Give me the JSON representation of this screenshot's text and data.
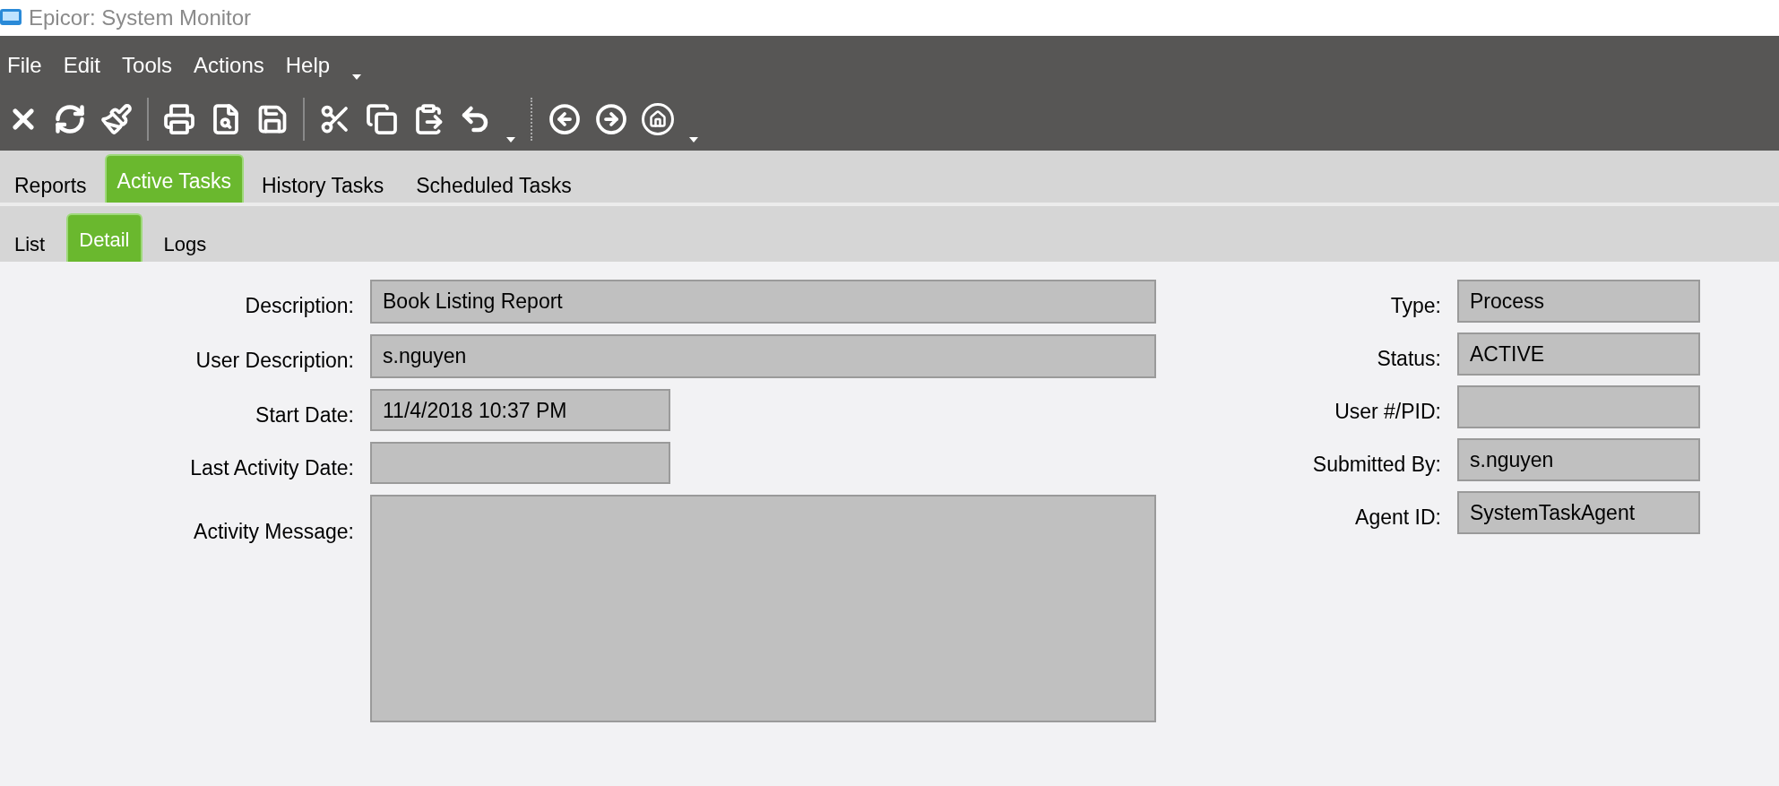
{
  "window": {
    "title": "Epicor: System Monitor"
  },
  "menu": [
    {
      "label": "File"
    },
    {
      "label": "Edit"
    },
    {
      "label": "Tools"
    },
    {
      "label": "Actions"
    },
    {
      "label": "Help"
    }
  ],
  "tabs": [
    {
      "label": "Reports",
      "selected": false
    },
    {
      "label": "Active Tasks",
      "selected": true
    },
    {
      "label": "History Tasks",
      "selected": false
    },
    {
      "label": "Scheduled Tasks",
      "selected": false
    }
  ],
  "subtabs": [
    {
      "label": "List",
      "selected": false
    },
    {
      "label": "Detail",
      "selected": true
    },
    {
      "label": "Logs",
      "selected": false
    }
  ],
  "left_fields": [
    {
      "label": "Description:",
      "value": "Book Listing Report",
      "kind": "wide"
    },
    {
      "label": "User Description:",
      "value": "s.nguyen",
      "kind": "wide"
    },
    {
      "label": "Start Date:",
      "value": "11/4/2018 10:37 PM",
      "kind": "short"
    },
    {
      "label": "Last Activity Date:",
      "kind": "short"
    },
    {
      "label": "Activity Message:",
      "kind": "multiline"
    }
  ],
  "right_fields": [
    {
      "label": "Type:",
      "value": "Process"
    },
    {
      "label": "Status:",
      "value": "ACTIVE"
    },
    {
      "label": "User #/PID:"
    },
    {
      "label": "Submitted By:",
      "value": "s.nguyen"
    },
    {
      "label": "Agent ID:",
      "value": "SystemTaskAgent"
    }
  ]
}
